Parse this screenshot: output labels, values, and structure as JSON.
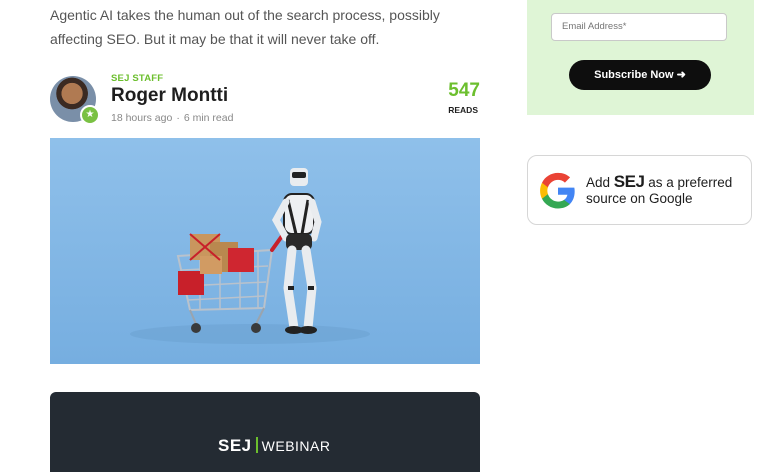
{
  "article": {
    "intro": "Agentic AI takes the human out of the search process, possibly affecting SEO. But it may be that it will never take off."
  },
  "author": {
    "tag": "SEJ STAFF",
    "name": "Roger Montti",
    "time_ago": "18 hours ago",
    "separator": "·",
    "read_time": "6 min read",
    "reads_count": "547",
    "reads_label": "READS"
  },
  "webinar": {
    "brand": "SEJ",
    "label": "WEBINAR"
  },
  "sidebar": {
    "newsletter": {
      "email_placeholder": "Email Address*",
      "subscribe_label": "Subscribe Now ➜"
    },
    "google": {
      "prefix": "Add",
      "brand": "SEJ",
      "suffix": "as a preferred",
      "line2": "source on Google"
    }
  },
  "colors": {
    "accent": "#6cbf2e",
    "newsletter_bg": "#dff5d6",
    "webinar_bg": "#242b33",
    "hero_bg": "#7fb5e4"
  }
}
